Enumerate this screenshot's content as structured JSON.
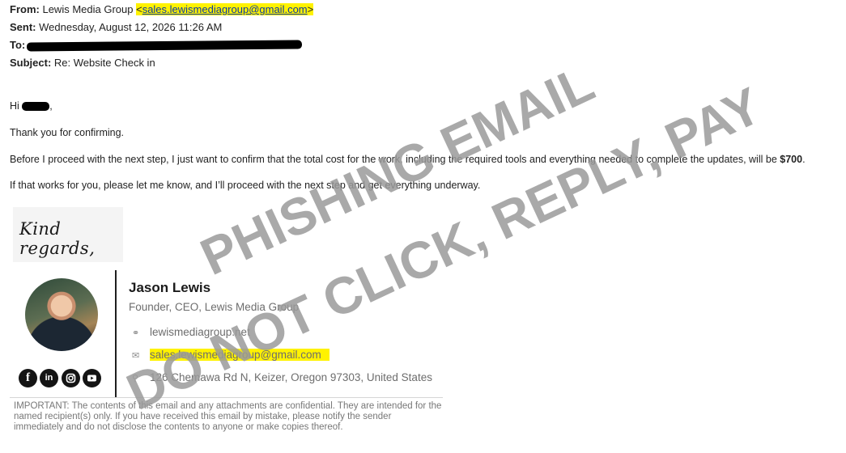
{
  "header": {
    "from_label": "From:",
    "from_name": "Lewis Media Group",
    "from_email": "sales.lewismediagroup@gmail.com",
    "sent_label": "Sent:",
    "sent_value": "Wednesday, August 12, 2026 11:26 AM",
    "to_label": "To:",
    "subject_label": "Subject:",
    "subject_value": "Re: Website Check in"
  },
  "body": {
    "greeting": "Hi",
    "line1": "Thank you for confirming.",
    "line2_pre": "Before I proceed with the next step, I just want to confirm that the total cost for the work, including the required tools and everything needed to complete the updates, will be ",
    "line2_amount": "$700",
    "line2_post": ".",
    "line3": "If that works for you, please let me know, and I’ll proceed with the next step and get everything underway."
  },
  "signature": {
    "closing": "Kind regards,",
    "name": "Jason Lewis",
    "title": "Founder, CEO, Lewis Media Group",
    "website": "lewismediagroup.net",
    "email": "sales.lewismediagroup@gmail.com",
    "address": "126 Chemawa Rd N, Keizer, Oregon 97303, United States",
    "social": [
      "facebook-icon",
      "linkedin-icon",
      "instagram-icon",
      "youtube-icon"
    ]
  },
  "disclaimer": "IMPORTANT: The contents of this email and any attachments are confidential. They are intended for the named recipient(s) only. If you have received this email by mistake, please notify the sender immediately and do not disclose the contents to anyone or make copies thereof.",
  "watermark": {
    "line1": "PHISHING EMAIL",
    "line2": "DO NOT CLICK, REPLY, PAY"
  },
  "colors": {
    "highlight": "#fff200",
    "link": "#0b3aa8",
    "watermark": "#9a9a9a"
  }
}
